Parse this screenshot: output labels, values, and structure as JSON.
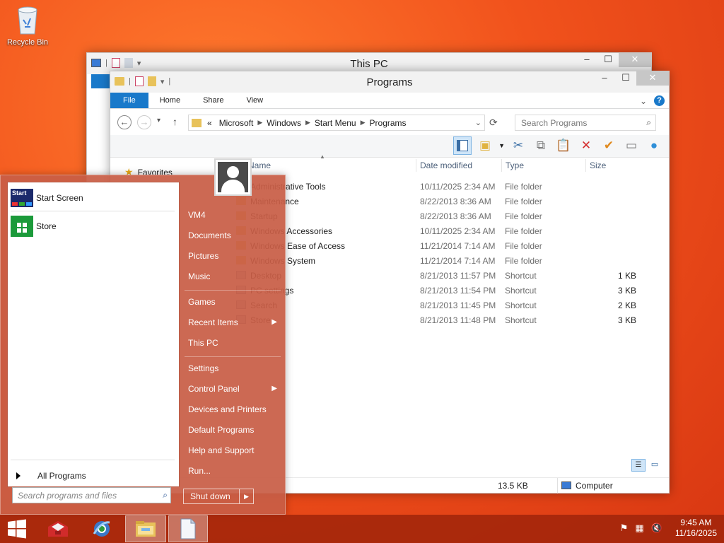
{
  "desktop": {
    "recycle_bin_label": "Recycle Bin"
  },
  "window_back": {
    "title": "This PC"
  },
  "explorer": {
    "title": "Programs",
    "ribbon_tabs": [
      "File",
      "Home",
      "Share",
      "View"
    ],
    "breadcrumb": {
      "overflow": "«",
      "items": [
        "Microsoft",
        "Windows",
        "Start Menu",
        "Programs"
      ]
    },
    "search_placeholder": "Search Programs",
    "nav_favorites": "Favorites",
    "columns": {
      "name": "Name",
      "date": "Date modified",
      "type": "Type",
      "size": "Size"
    },
    "rows": [
      {
        "name": "Administrative Tools",
        "date": "10/11/2025 2:34 AM",
        "type": "File folder",
        "size": ""
      },
      {
        "name": "Maintenance",
        "date": "8/22/2013 8:36 AM",
        "type": "File folder",
        "size": ""
      },
      {
        "name": "Startup",
        "date": "8/22/2013 8:36 AM",
        "type": "File folder",
        "size": ""
      },
      {
        "name": "Windows Accessories",
        "date": "10/11/2025 2:34 AM",
        "type": "File folder",
        "size": ""
      },
      {
        "name": "Windows Ease of Access",
        "date": "11/21/2014 7:14 AM",
        "type": "File folder",
        "size": ""
      },
      {
        "name": "Windows System",
        "date": "11/21/2014 7:14 AM",
        "type": "File folder",
        "size": ""
      },
      {
        "name": "Desktop",
        "date": "8/21/2013 11:57 PM",
        "type": "Shortcut",
        "size": "1 KB"
      },
      {
        "name": "PC settings",
        "date": "8/21/2013 11:54 PM",
        "type": "Shortcut",
        "size": "3 KB"
      },
      {
        "name": "Search",
        "date": "8/21/2013 11:45 PM",
        "type": "Shortcut",
        "size": "2 KB"
      },
      {
        "name": "Store",
        "date": "8/21/2013 11:48 PM",
        "type": "Shortcut",
        "size": "3 KB"
      }
    ],
    "status": {
      "size": "13.5 KB",
      "location": "Computer"
    }
  },
  "start_menu": {
    "pinned": [
      {
        "label": "Start Screen",
        "tile_text": "Start"
      },
      {
        "label": "Store"
      }
    ],
    "all_programs": "All Programs",
    "search_placeholder": "Search programs and files",
    "right_items": [
      {
        "label": "VM4",
        "sub": false
      },
      {
        "label": "Documents",
        "sub": false
      },
      {
        "label": "Pictures",
        "sub": false
      },
      {
        "label": "Music",
        "sub": false
      },
      {
        "label": "Games",
        "sub": false
      },
      {
        "label": "Recent Items",
        "sub": true
      },
      {
        "label": "This PC",
        "sub": false
      },
      {
        "label": "Settings",
        "sub": false
      },
      {
        "label": "Control Panel",
        "sub": true
      },
      {
        "label": "Devices and Printers",
        "sub": false
      },
      {
        "label": "Default Programs",
        "sub": false
      },
      {
        "label": "Help and Support",
        "sub": false
      },
      {
        "label": "Run...",
        "sub": false
      }
    ],
    "shutdown_label": "Shut down"
  },
  "taskbar": {
    "time": "9:45 AM",
    "date": "11/16/2025"
  },
  "colors": {
    "desktop": "#f1521c",
    "accent_blue": "#1979ca",
    "start_menu": "#c85e46",
    "taskbar": "#a0240a"
  }
}
